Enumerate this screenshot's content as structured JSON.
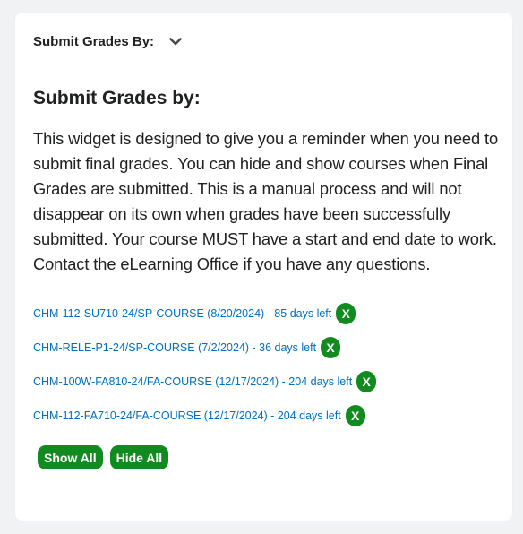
{
  "widget": {
    "title": "Submit Grades By:",
    "toggle_icon": "chevron-down-icon"
  },
  "content": {
    "heading": "Submit Grades by:",
    "description": "This widget is designed to give you a reminder when you need to submit final grades. You can hide and show courses when Final Grades are submitted. This is a manual process and will not disappear on its own when grades have been successfully submitted.  Your course MUST have a start and end date to work.   Contact the eLearning Office if you have any questions."
  },
  "courses": [
    {
      "label": "CHM-112-SU710-24/SP-COURSE (8/20/2024) - 85 days left",
      "hide_label": "X"
    },
    {
      "label": "CHM-RELE-P1-24/SP-COURSE (7/2/2024) - 36 days left",
      "hide_label": "X"
    },
    {
      "label": "CHM-100W-FA810-24/FA-COURSE (12/17/2024) - 204 days left",
      "hide_label": "X"
    },
    {
      "label": "CHM-112-FA710-24/FA-COURSE (12/17/2024) - 204 days left",
      "hide_label": "X"
    }
  ],
  "actions": {
    "show_all": "Show All",
    "hide_all": "Hide All"
  },
  "colors": {
    "accent_green": "#118b1f",
    "link_blue": "#006fbf",
    "text": "#202122",
    "background": "#f1f2f4"
  }
}
